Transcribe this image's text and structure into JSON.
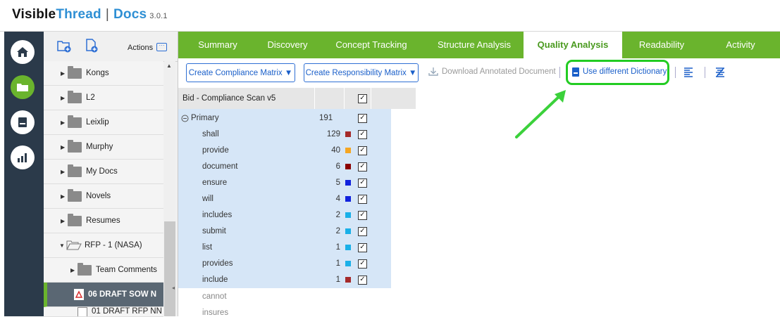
{
  "header": {
    "brand_a": "Visible",
    "brand_b": "Thread",
    "sep": "|",
    "product": "Docs",
    "version": "3.0.1"
  },
  "tree": {
    "actions_label": "Actions",
    "items": [
      {
        "label": "Kongs"
      },
      {
        "label": "L2"
      },
      {
        "label": "Leixlip"
      },
      {
        "label": "Murphy"
      },
      {
        "label": "My Docs"
      },
      {
        "label": "Novels"
      },
      {
        "label": "Resumes"
      },
      {
        "label": "RFP - 1 (NASA)"
      },
      {
        "label": "Team Comments"
      },
      {
        "label": "06 DRAFT SOW N"
      },
      {
        "label": "01 DRAFT RFP NN"
      }
    ]
  },
  "tabs": [
    "Summary",
    "Discovery",
    "Concept Tracking",
    "Structure Analysis",
    "Quality Analysis",
    "Readability",
    "Activity"
  ],
  "toolbar": {
    "compliance": "Create Compliance Matrix ▼",
    "responsibility": "Create Responsibility Matrix ▼",
    "download": "Download Annotated Document",
    "dictionary": "Use different Dictionary"
  },
  "table": {
    "title": "Bid - Compliance Scan v5",
    "group": "Primary",
    "group_count": "191",
    "rows": [
      {
        "word": "shall",
        "count": "129",
        "color": "#a52a2a"
      },
      {
        "word": "provide",
        "count": "40",
        "color": "#f5a623"
      },
      {
        "word": "document",
        "count": "6",
        "color": "#8b0000"
      },
      {
        "word": "ensure",
        "count": "5",
        "color": "#1122dd"
      },
      {
        "word": "will",
        "count": "4",
        "color": "#1122dd"
      },
      {
        "word": "includes",
        "count": "2",
        "color": "#1ab0e8"
      },
      {
        "word": "submit",
        "count": "2",
        "color": "#1ab0e8"
      },
      {
        "word": "list",
        "count": "1",
        "color": "#1ab0e8"
      },
      {
        "word": "provides",
        "count": "1",
        "color": "#1ab0e8"
      },
      {
        "word": "include",
        "count": "1",
        "color": "#a52a2a"
      }
    ],
    "extra": [
      {
        "word": "cannot"
      },
      {
        "word": "insures"
      }
    ]
  },
  "colors": {
    "accent_green": "#6ab42d",
    "highlight_green": "#22cc22",
    "row_blue": "#d6e6f7"
  }
}
